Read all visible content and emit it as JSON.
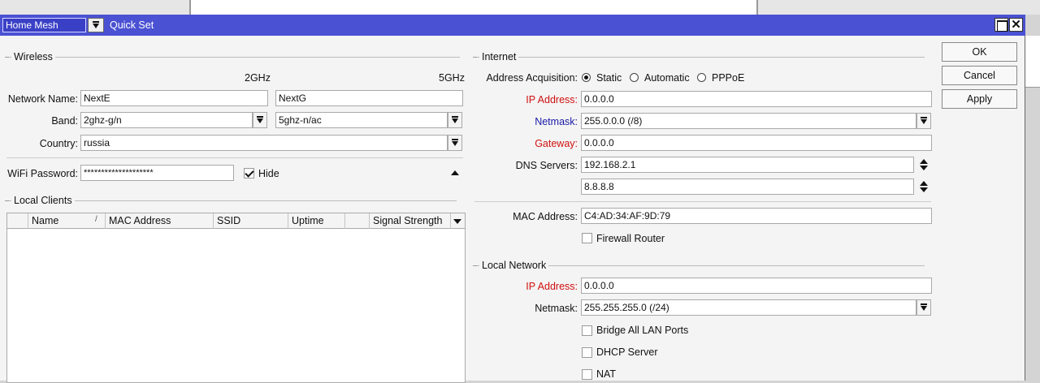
{
  "window": {
    "mode": "Home Mesh",
    "title": "Quick Set"
  },
  "buttons": {
    "ok": "OK",
    "cancel": "Cancel",
    "apply": "Apply"
  },
  "wireless": {
    "title": "Wireless",
    "col_2ghz": "2GHz",
    "col_5ghz": "5GHz",
    "network_name_label": "Network Name:",
    "network_name_2g": "NextE",
    "network_name_5g": "NextG",
    "band_label": "Band:",
    "band_2g": "2ghz-g/n",
    "band_5g": "5ghz-n/ac",
    "country_label": "Country:",
    "country": "russia",
    "wifi_password_label": "WiFi Password:",
    "wifi_password": "********************",
    "hide_label": "Hide",
    "hide_checked": true
  },
  "local_clients": {
    "title": "Local Clients",
    "columns": [
      "Name",
      "/",
      "MAC Address",
      "SSID",
      "Uptime",
      "",
      "Signal Strength"
    ],
    "rows": []
  },
  "internet": {
    "title": "Internet",
    "acquisition_label": "Address Acquisition:",
    "acquisition_options": [
      "Static",
      "Automatic",
      "PPPoE"
    ],
    "acquisition_selected": "Static",
    "ip_label": "IP Address:",
    "ip": "0.0.0.0",
    "netmask_label": "Netmask:",
    "netmask": "255.0.0.0 (/8)",
    "gateway_label": "Gateway:",
    "gateway": "0.0.0.0",
    "dns_label": "DNS Servers:",
    "dns_1": "192.168.2.1",
    "dns_2": "8.8.8.8",
    "mac_label": "MAC Address:",
    "mac": "C4:AD:34:AF:9D:79",
    "firewall_label": "Firewall Router",
    "firewall_checked": false
  },
  "local_network": {
    "title": "Local Network",
    "ip_label": "IP Address:",
    "ip": "0.0.0.0",
    "netmask_label": "Netmask:",
    "netmask": "255.255.255.0 (/24)",
    "bridge_label": "Bridge All LAN Ports",
    "dhcp_label": "DHCP Server",
    "nat_label": "NAT"
  },
  "colors": {
    "titlebar": "#4a51d3",
    "required_label": "#d01010",
    "optional_label": "#1a1aa8"
  }
}
